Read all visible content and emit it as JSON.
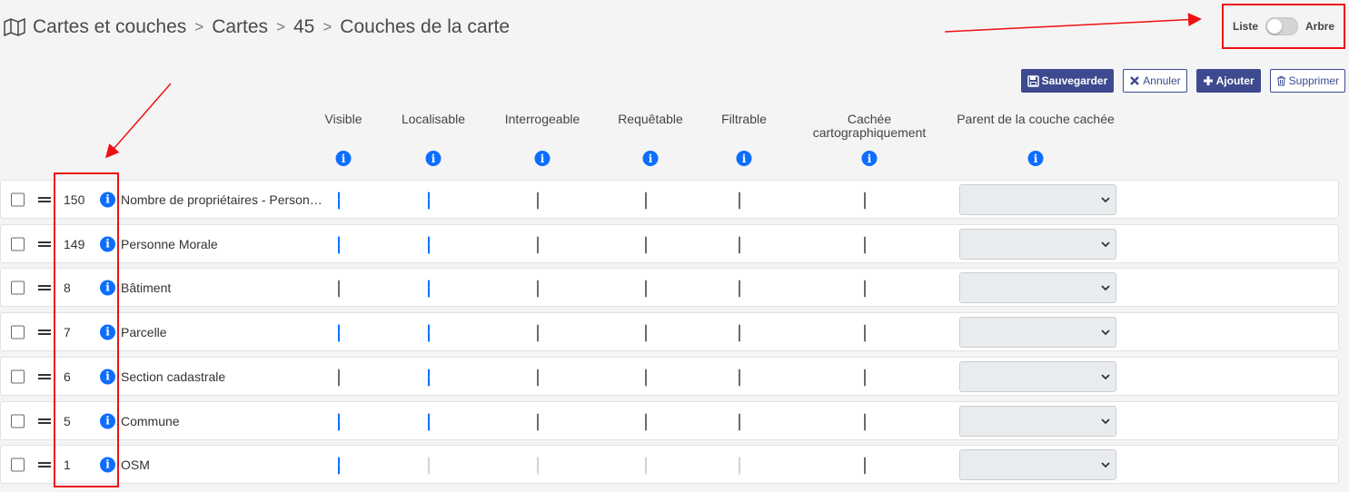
{
  "breadcrumb": {
    "icon": "map-icon",
    "items": [
      "Cartes et couches",
      "Cartes",
      "45",
      "Couches de la carte"
    ],
    "separator": ">"
  },
  "view_toggle": {
    "left_label": "Liste",
    "right_label": "Arbre",
    "state": "Liste"
  },
  "toolbar": {
    "save_label": "Sauvegarder",
    "cancel_label": "Annuler",
    "add_label": "Ajouter",
    "delete_label": "Supprimer"
  },
  "columns": {
    "visible": "Visible",
    "localisable": "Localisable",
    "interrogeable": "Interrogeable",
    "requetable": "Requêtable",
    "filtrable": "Filtrable",
    "cachee_line1": "Cachée",
    "cachee_line2": "cartographiquement",
    "parent": "Parent de la couche cachée"
  },
  "rows": [
    {
      "id": "150",
      "name": "Nombre de propriétaires - Personne Morale",
      "visible": "checked",
      "localisable": "checked",
      "interrogeable": "unchecked",
      "requetable": "unchecked",
      "filtrable": "unchecked",
      "cachee": "unchecked"
    },
    {
      "id": "149",
      "name": "Personne Morale",
      "visible": "checked",
      "localisable": "checked",
      "interrogeable": "unchecked",
      "requetable": "unchecked",
      "filtrable": "unchecked",
      "cachee": "unchecked"
    },
    {
      "id": "8",
      "name": "Bâtiment",
      "visible": "unchecked",
      "localisable": "checked",
      "interrogeable": "unchecked",
      "requetable": "unchecked",
      "filtrable": "unchecked",
      "cachee": "unchecked"
    },
    {
      "id": "7",
      "name": "Parcelle",
      "visible": "checked",
      "localisable": "checked",
      "interrogeable": "unchecked",
      "requetable": "unchecked",
      "filtrable": "unchecked",
      "cachee": "unchecked"
    },
    {
      "id": "6",
      "name": "Section cadastrale",
      "visible": "unchecked",
      "localisable": "checked",
      "interrogeable": "unchecked",
      "requetable": "unchecked",
      "filtrable": "unchecked",
      "cachee": "unchecked"
    },
    {
      "id": "5",
      "name": "Commune",
      "visible": "checked",
      "localisable": "checked",
      "interrogeable": "unchecked",
      "requetable": "unchecked",
      "filtrable": "unchecked",
      "cachee": "unchecked"
    },
    {
      "id": "1",
      "name": "OSM",
      "visible": "checked",
      "localisable": "disabled",
      "interrogeable": "disabled",
      "requetable": "disabled",
      "filtrable": "disabled",
      "cachee": "unchecked"
    }
  ],
  "colors": {
    "primary": "#3d4a8f",
    "info": "#0d6efd",
    "checkbox": "#0d6efd",
    "annotation": "#e11111"
  }
}
